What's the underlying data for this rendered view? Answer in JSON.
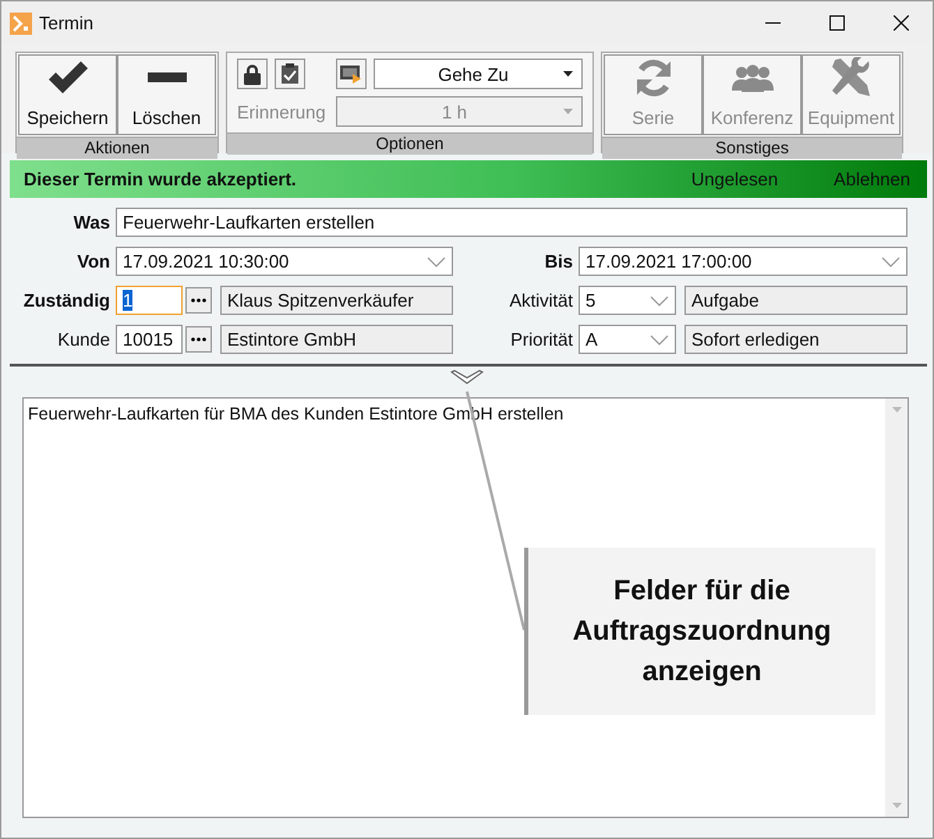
{
  "window": {
    "title": "Termin"
  },
  "ribbon": {
    "groups": [
      {
        "kind": "actions",
        "label": "Aktionen",
        "buttons": [
          {
            "kind": "save",
            "label": "Speichern",
            "disabled": false
          },
          {
            "kind": "delete",
            "label": "Löschen",
            "disabled": false
          }
        ]
      },
      {
        "kind": "options",
        "label": "Optionen",
        "goto": {
          "value": "Gehe Zu"
        },
        "reminder": {
          "label": "Erinnerung",
          "value": "1 h",
          "disabled": true
        }
      },
      {
        "kind": "actions",
        "label": "Sonstiges",
        "buttons": [
          {
            "kind": "series",
            "label": "Serie",
            "disabled": true
          },
          {
            "kind": "conference",
            "label": "Konferenz",
            "disabled": true
          },
          {
            "kind": "equipment",
            "label": "Equipment",
            "disabled": true
          }
        ]
      }
    ]
  },
  "banner": {
    "message": "Dieser Termin wurde akzeptiert.",
    "links": [
      "Ungelesen",
      "Ablehnen"
    ]
  },
  "form": {
    "rows": [
      [
        {
          "kind": "text",
          "label": "Was",
          "bold": true,
          "value": "Feuerwehr-Laufkarten erstellen"
        }
      ],
      [
        {
          "kind": "date",
          "label": "Von",
          "bold": true,
          "value": "17.09.2021 10:30:00"
        },
        {
          "kind": "date",
          "label": "Bis",
          "bold": true,
          "value": "17.09.2021 17:00:00"
        }
      ],
      [
        {
          "kind": "lookup",
          "label": "Zuständig",
          "bold": true,
          "value": "1",
          "focused": true,
          "description": "Klaus Spitzenverkäufer"
        },
        {
          "kind": "combo",
          "label": "Aktivität",
          "bold": false,
          "value": "5",
          "description": "Aufgabe"
        }
      ],
      [
        {
          "kind": "lookup",
          "label": "Kunde",
          "bold": false,
          "value": "10015",
          "focused": false,
          "description": "Estintore GmbH"
        },
        {
          "kind": "combo",
          "label": "Priorität",
          "bold": false,
          "value": "A",
          "description": "Sofort erledigen"
        }
      ]
    ]
  },
  "notes": {
    "text": "Feuerwehr-Laufkarten für BMA des Kunden Estintore GmbH erstellen"
  },
  "callout": {
    "text": "Felder für die Auftragszuordnung anzeigen"
  }
}
